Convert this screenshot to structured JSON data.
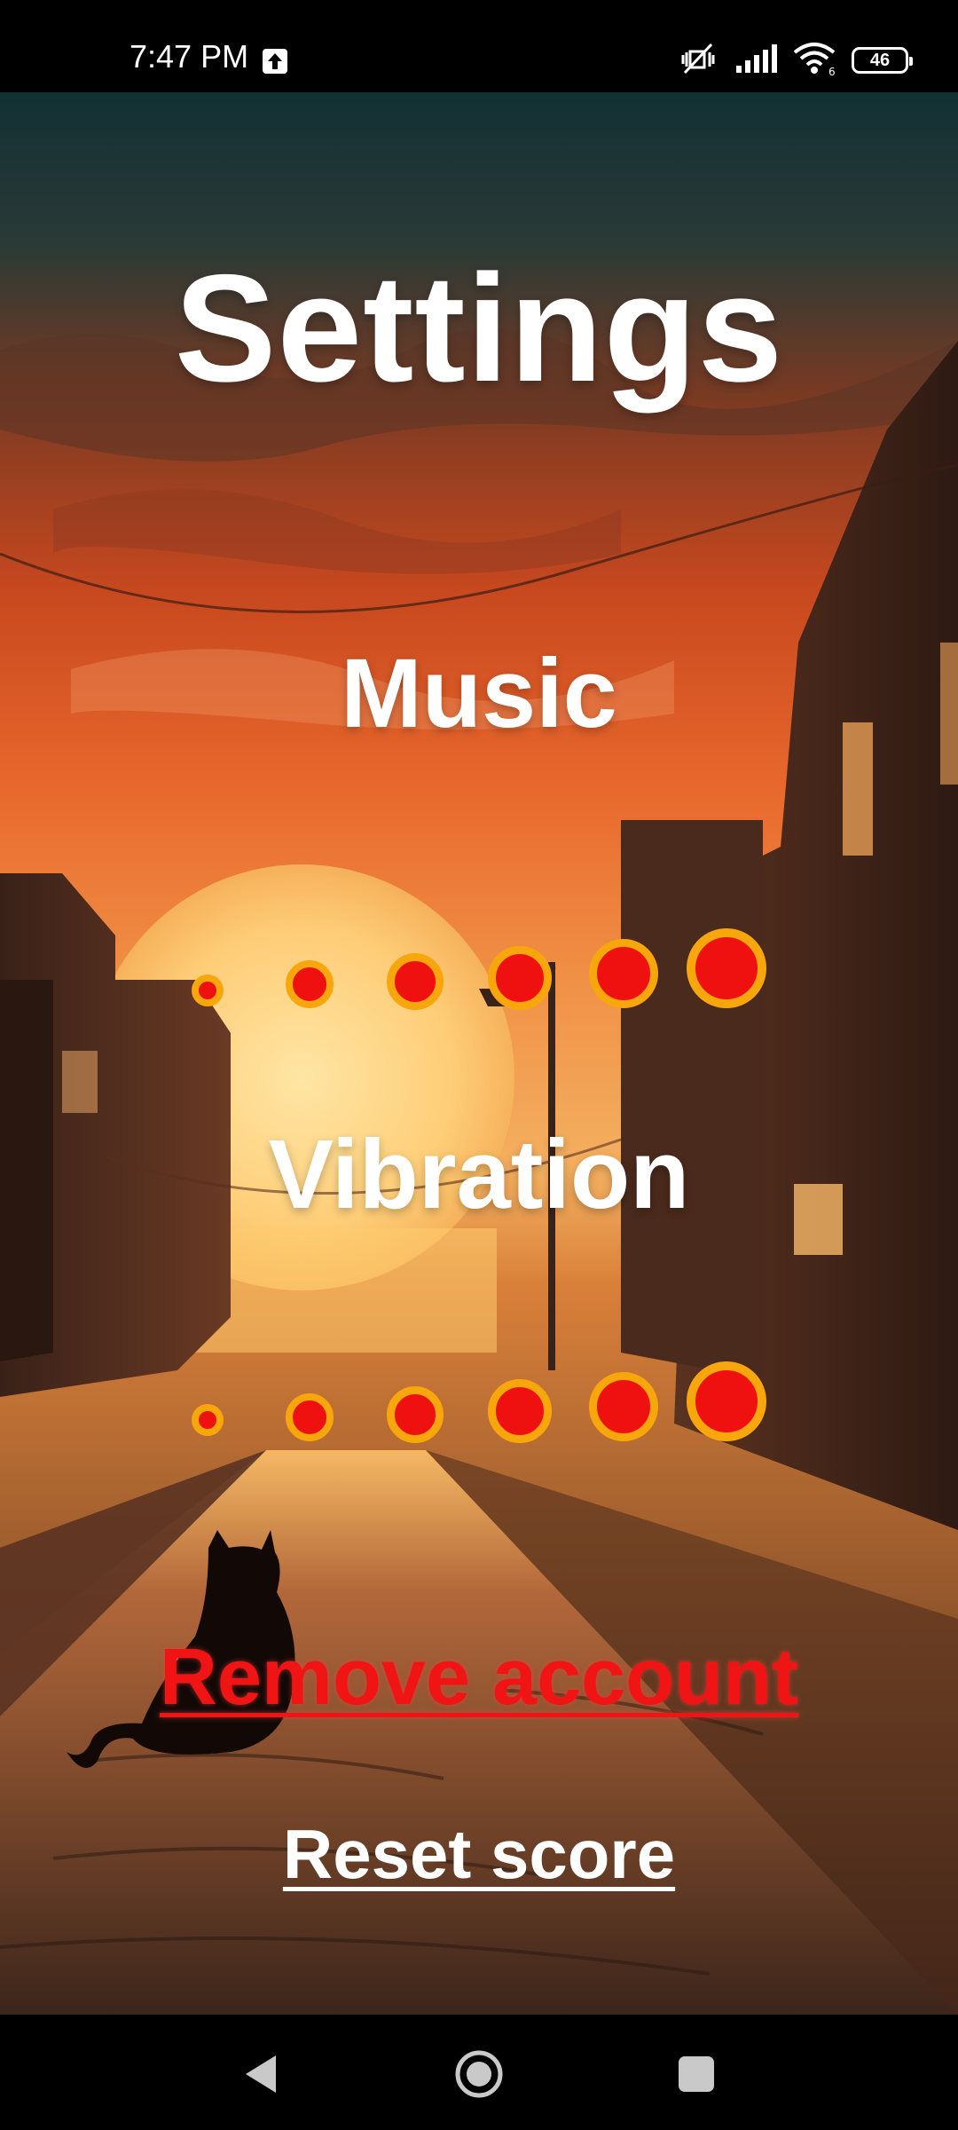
{
  "status_bar": {
    "time": "7:47 PM",
    "battery_level": "46",
    "icons": [
      "upload-notification-icon",
      "mute-vibrate-icon",
      "signal-icon",
      "wifi-icon",
      "battery-icon"
    ]
  },
  "screen": {
    "title": "Settings",
    "music": {
      "label": "Music",
      "levels": 6
    },
    "vibration": {
      "label": "Vibration",
      "levels": 6
    },
    "remove_account_label": "Remove account",
    "reset_score_label": "Reset score"
  },
  "colors": {
    "dot_fill": "#ef1010",
    "dot_ring": "#f7a70c",
    "remove_account": "#f01414",
    "text": "#ffffff"
  },
  "nav_bar": {
    "buttons": [
      "back-icon",
      "home-icon",
      "recents-icon"
    ]
  }
}
